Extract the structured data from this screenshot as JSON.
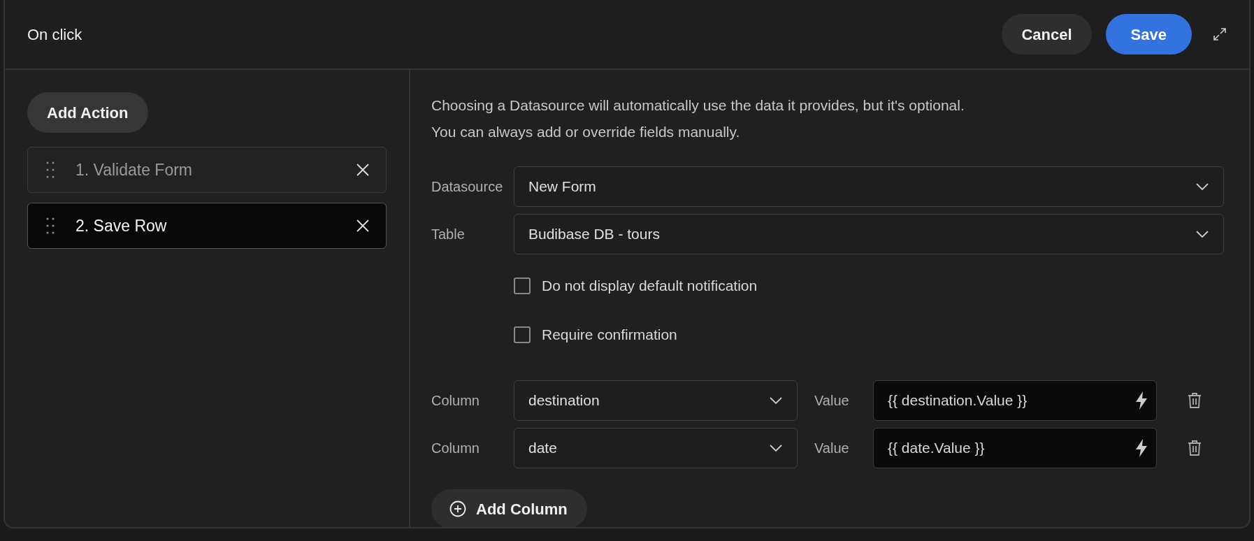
{
  "window": {
    "title": "On click"
  },
  "header_buttons": [
    {
      "label": "Cancel",
      "kind": "secondary"
    },
    {
      "label": "Save",
      "kind": "primary"
    }
  ],
  "add_action": {
    "label": "Add Action"
  },
  "actions": [
    {
      "label": "1. Validate Form",
      "selected": false
    },
    {
      "label": "2. Save Row",
      "selected": true
    }
  ],
  "description": [
    "Choosing a Datasource will automatically use the data it provides, but it's optional.",
    "You can always add or override fields manually."
  ],
  "fields": [
    {
      "label": "Datasource",
      "value": "New Form"
    },
    {
      "label": "Table",
      "value": "Budibase DB - tours"
    }
  ],
  "options": [
    {
      "label": "Do not display default notification",
      "checked": false
    },
    {
      "label": "Require confirmation",
      "checked": false
    }
  ],
  "columns": [
    {
      "column_label": "Column",
      "column": "destination",
      "value_label": "Value",
      "value": "{{ destination.Value }}"
    },
    {
      "column_label": "Column",
      "column": "date",
      "value_label": "Value",
      "value": "{{ date.Value }}"
    }
  ],
  "add_column": {
    "label": "Add Column"
  }
}
